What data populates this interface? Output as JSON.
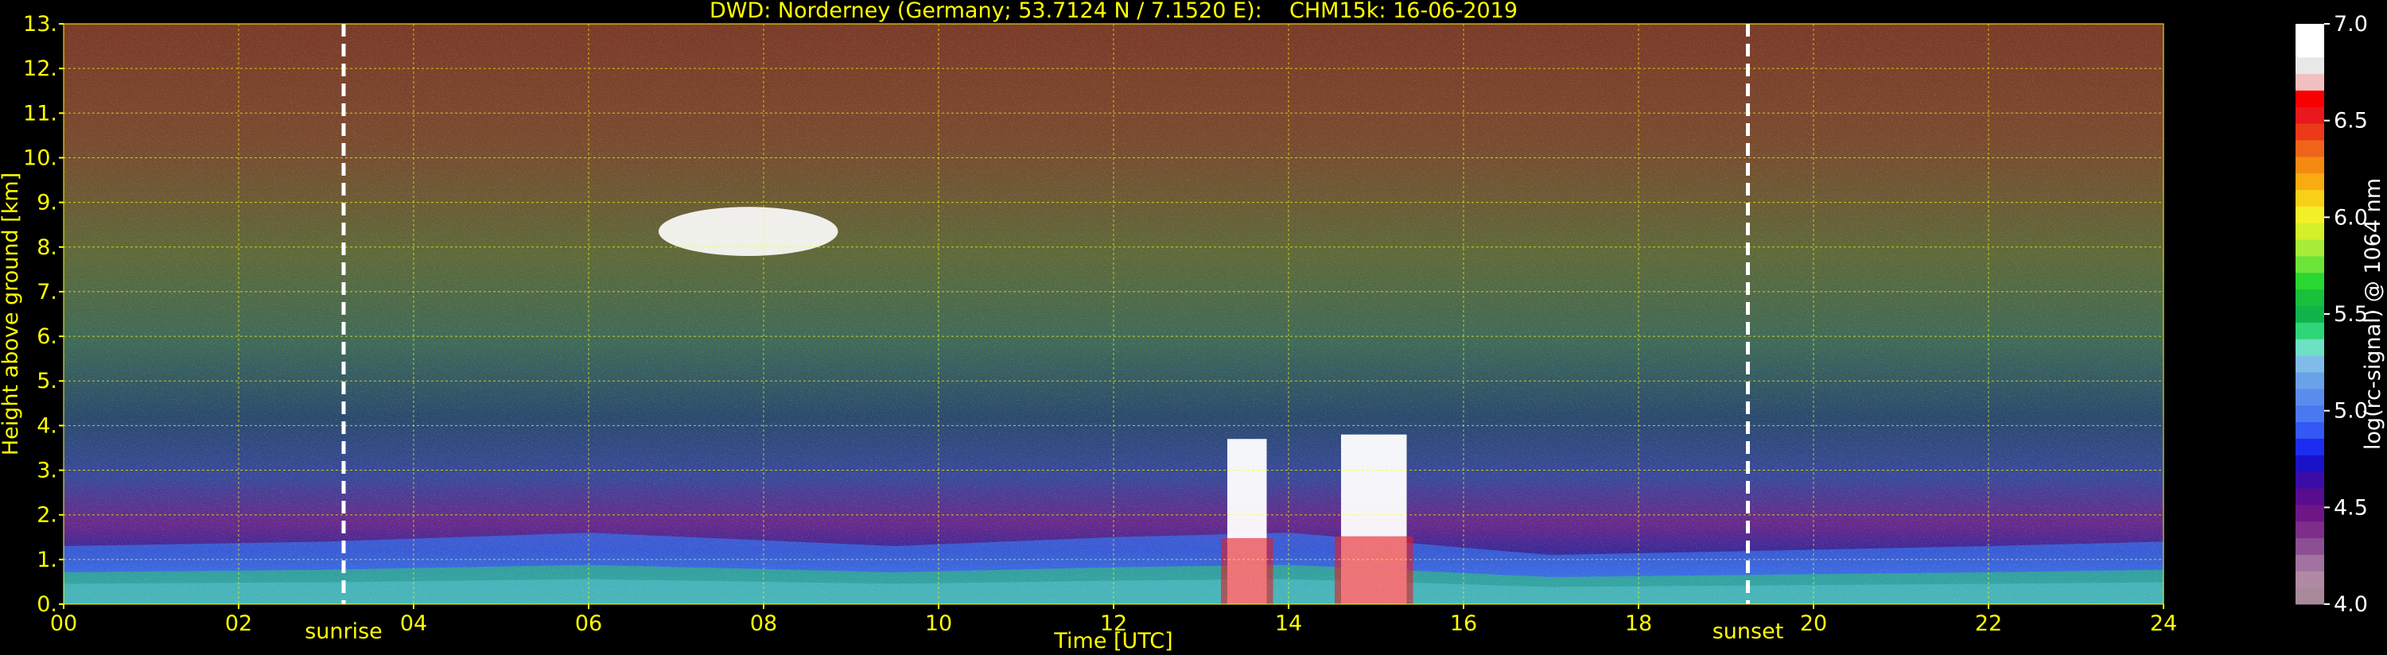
{
  "colors": {
    "background": "#000000",
    "text": "#ffff00",
    "grid": "#ffff00",
    "marker": "#ffffff",
    "colorbar_text": "#ffffff"
  },
  "chart_data": {
    "type": "heatmap",
    "title": "DWD: Norderney (Germany; 53.7124 N / 7.1520 E):    CHM15k: 16-06-2019",
    "xlabel": "Time [UTC]",
    "ylabel": "Height above ground [km]",
    "xlim": [
      0,
      24
    ],
    "ylim": [
      0,
      13
    ],
    "x_ticks": [
      "00",
      "02",
      "04",
      "06",
      "08",
      "10",
      "12",
      "14",
      "16",
      "18",
      "20",
      "22",
      "24"
    ],
    "y_ticks": [
      "0.",
      "1.",
      "2.",
      "3.",
      "4.",
      "5.",
      "6.",
      "7.",
      "8.",
      "9.",
      "10.",
      "11.",
      "12.",
      "13."
    ],
    "grid": true,
    "events": [
      {
        "label": "sunrise",
        "time": 3.2
      },
      {
        "label": "sunset",
        "time": 19.25
      }
    ],
    "colorbar": {
      "label": "log(rc-signal) @ 1064 nm",
      "range": [
        4.0,
        7.0
      ],
      "ticks": [
        "4.0",
        "4.5",
        "5.0",
        "5.5",
        "6.0",
        "6.5",
        "7.0"
      ],
      "bands": [
        "#a8899a",
        "#b08aa4",
        "#a272a0",
        "#8e4e94",
        "#7e2e8a",
        "#6e1686",
        "#5a0c8e",
        "#3c0ca8",
        "#1a12c8",
        "#1c2cf0",
        "#3458f4",
        "#4a78f0",
        "#5a8cee",
        "#6aa2ea",
        "#80bce8",
        "#6ee0c4",
        "#2ed678",
        "#10b44a",
        "#18c03c",
        "#2ad632",
        "#6ce43a",
        "#a6ec38",
        "#d4f028",
        "#f4f028",
        "#f8d018",
        "#f8ac12",
        "#f48a10",
        "#f0641a",
        "#ea3a18",
        "#e8181c",
        "#f80000",
        "#f2c0c0",
        "#e8e8e8",
        "#ffffff",
        "#ffffff"
      ]
    },
    "cloud_features": [
      {
        "type": "cirrus",
        "t_start": 6.8,
        "t_end": 8.85,
        "h_low": 7.8,
        "h_high": 8.9
      },
      {
        "type": "convective",
        "t_start": 13.3,
        "t_end": 13.75,
        "h_low": 0.0,
        "h_high": 3.7
      },
      {
        "type": "convective",
        "t_start": 14.6,
        "t_end": 15.35,
        "h_low": 0.0,
        "h_high": 3.8
      }
    ],
    "boundary_layer": [
      {
        "t": 0,
        "h": 1.3
      },
      {
        "t": 3,
        "h": 1.4
      },
      {
        "t": 6,
        "h": 1.6
      },
      {
        "t": 9.5,
        "h": 1.3
      },
      {
        "t": 12,
        "h": 1.5
      },
      {
        "t": 14,
        "h": 1.6
      },
      {
        "t": 17,
        "h": 1.1
      },
      {
        "t": 19.5,
        "h": 1.2
      },
      {
        "t": 22,
        "h": 1.3
      },
      {
        "t": 24,
        "h": 1.4
      }
    ]
  }
}
